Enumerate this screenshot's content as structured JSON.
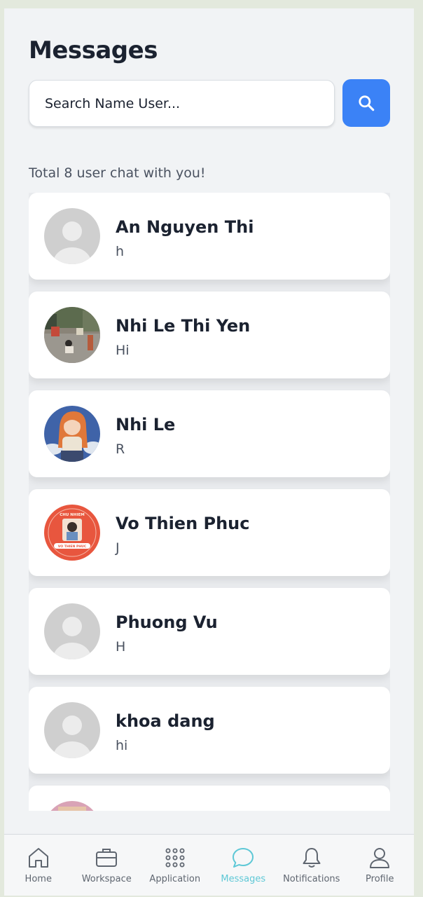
{
  "header": {
    "title": "Messages"
  },
  "search": {
    "placeholder": "Search Name User..."
  },
  "count_text": "Total 8 user chat with you!",
  "chats": [
    {
      "name": "An Nguyen Thi",
      "last_message": "h",
      "avatar": "default-avatar"
    },
    {
      "name": "Nhi Le Thi Yen",
      "last_message": "Hi",
      "avatar": "photo-street"
    },
    {
      "name": "Nhi Le",
      "last_message": "R",
      "avatar": "photo-anime-girl"
    },
    {
      "name": "Vo Thien Phuc",
      "last_message": "J",
      "avatar": "photo-badge",
      "avatar_text_top": "CHU NHIEM",
      "avatar_text_bottom": "VO THIEN PHUC"
    },
    {
      "name": "Phuong Vu",
      "last_message": "H",
      "avatar": "default-avatar"
    },
    {
      "name": "khoa dang",
      "last_message": "hi",
      "avatar": "default-avatar"
    },
    {
      "name": "",
      "last_message": "",
      "avatar": "photo-partial"
    }
  ],
  "nav": [
    {
      "label": "Home",
      "icon": "home-icon",
      "active": false
    },
    {
      "label": "Workspace",
      "icon": "briefcase-icon",
      "active": false
    },
    {
      "label": "Application",
      "icon": "grid-icon",
      "active": false
    },
    {
      "label": "Messages",
      "icon": "chat-bubble-icon",
      "active": true
    },
    {
      "label": "Notifications",
      "icon": "bell-icon",
      "active": false
    },
    {
      "label": "Profile",
      "icon": "user-icon",
      "active": false
    }
  ],
  "colors": {
    "accent": "#3b82f6",
    "active_nav": "#5ec8d6",
    "background": "#f1f3f5"
  }
}
